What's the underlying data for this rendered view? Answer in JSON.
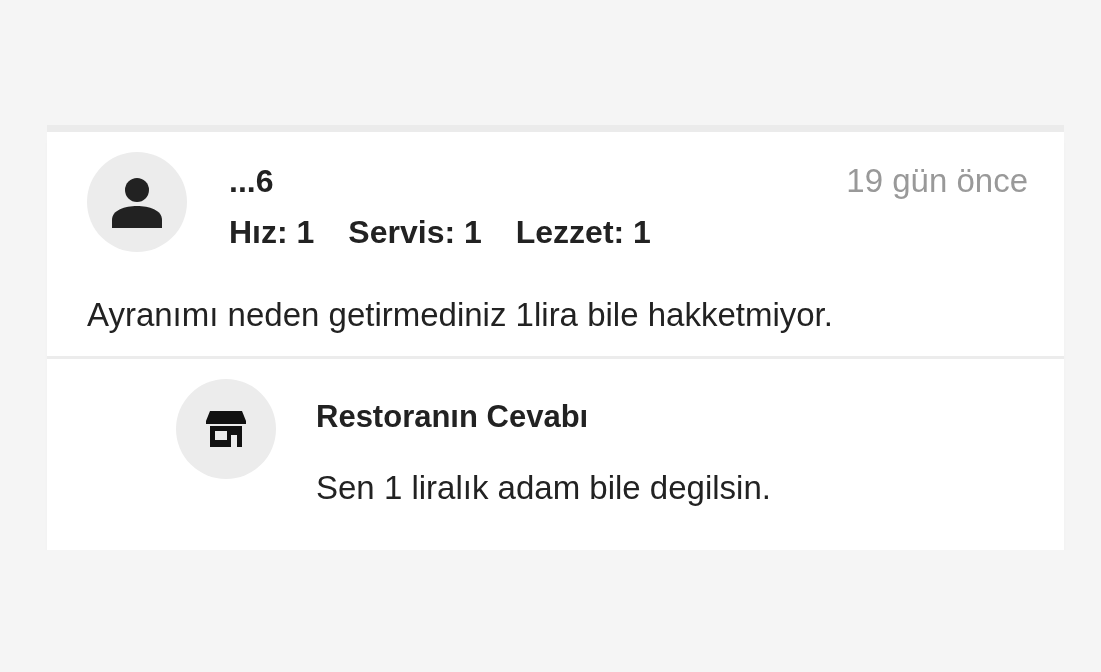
{
  "review": {
    "user": "...6",
    "time": "19 gün önce",
    "ratings": [
      "Hız: 1",
      "Servis: 1",
      "Lezzet: 1"
    ],
    "comment": "Ayranımı neden getirmediniz 1lira bile hakketmiyor."
  },
  "reply": {
    "title": "Restoranın Cevabı",
    "text": "Sen 1 liralık adam bile degilsin."
  }
}
